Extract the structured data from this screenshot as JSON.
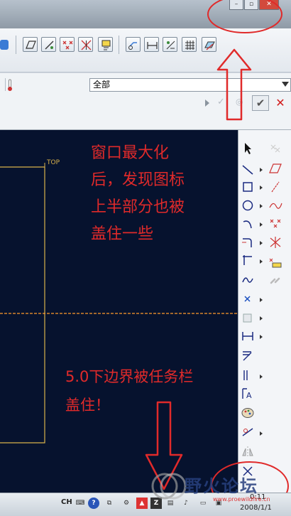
{
  "filter": {
    "value": "全部"
  },
  "canvas": {
    "view_label": "TOP"
  },
  "annotations": {
    "note1": [
      "窗口最大化",
      "后，发现图标",
      "上半部分也被",
      "盖住一些"
    ],
    "note2": [
      "5.0下边界被任务栏",
      "盖住！"
    ]
  },
  "taskbar": {
    "lang": "CH",
    "clock_time": "0:11",
    "clock_date": "2008/1/1"
  },
  "watermark": {
    "brand": "野火论坛",
    "url": "www.proewildfire.cn"
  },
  "colors": {
    "canvas_bg": "#06122e",
    "annotation_red": "#e02a2a",
    "view_outline": "#d9b24b",
    "axis_orange": "#ff9a2a"
  }
}
